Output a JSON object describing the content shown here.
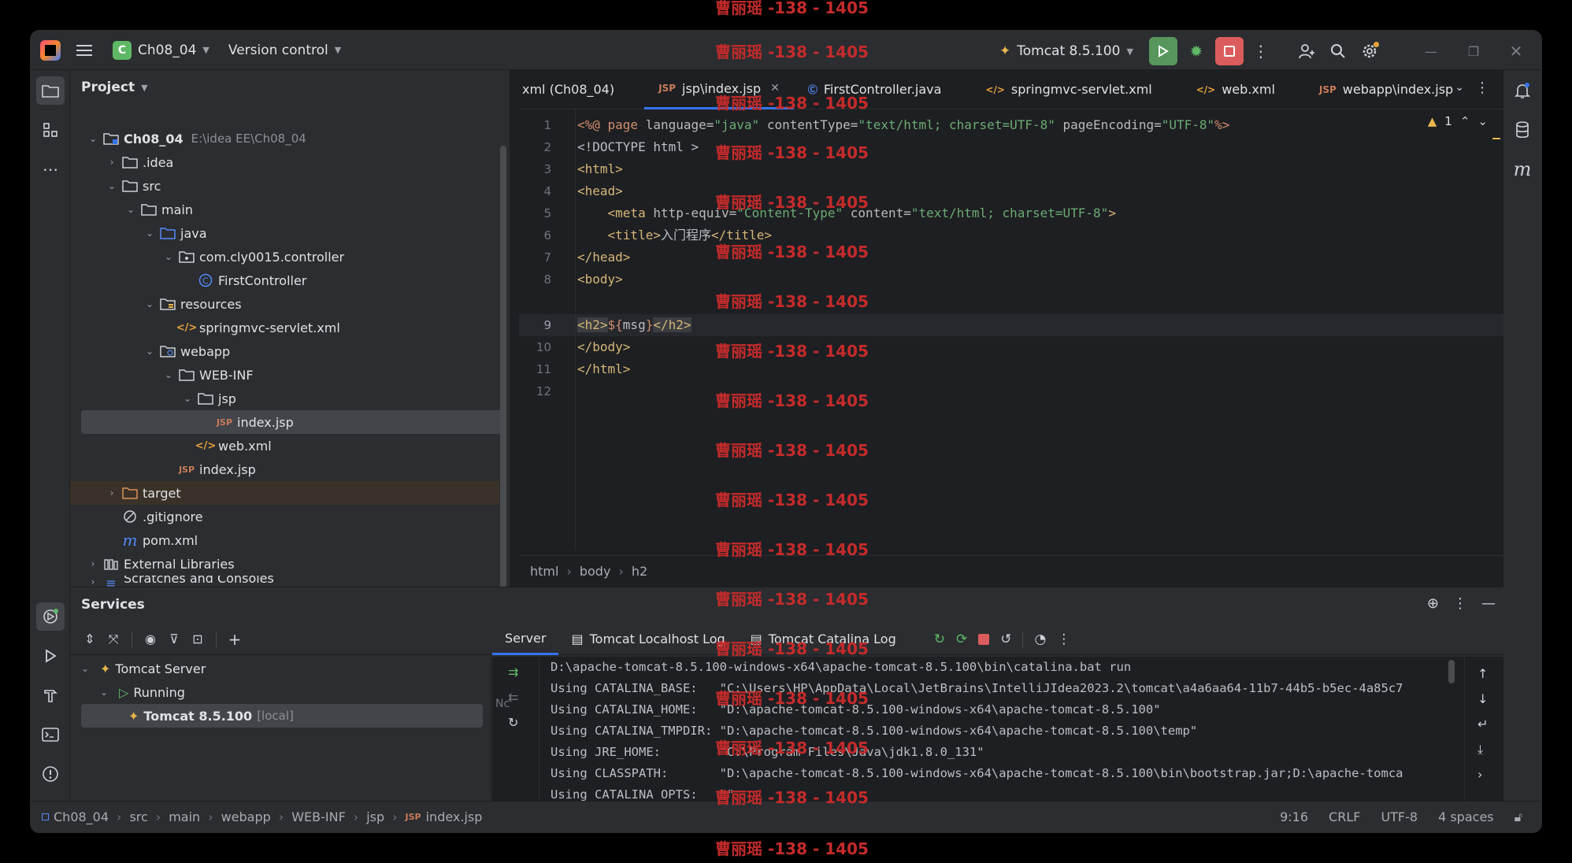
{
  "watermark": "曹丽瑶 -138 - 1405",
  "titlebar": {
    "project_badge": "C",
    "project_name": "Ch08_04",
    "version_control": "Version control",
    "run_config": "Tomcat 8.5.100"
  },
  "project_panel": {
    "title": "Project",
    "tree": [
      {
        "label": "Ch08_04",
        "extra": "E:\\idea EE\\Ch08_04"
      },
      {
        "label": ".idea"
      },
      {
        "label": "src"
      },
      {
        "label": "main"
      },
      {
        "label": "java"
      },
      {
        "label": "com.cly0015.controller"
      },
      {
        "label": "FirstController"
      },
      {
        "label": "resources"
      },
      {
        "label": "springmvc-servlet.xml"
      },
      {
        "label": "webapp"
      },
      {
        "label": "WEB-INF"
      },
      {
        "label": "jsp"
      },
      {
        "label": "index.jsp"
      },
      {
        "label": "web.xml"
      },
      {
        "label": "index.jsp"
      },
      {
        "label": "target"
      },
      {
        "label": ".gitignore"
      },
      {
        "label": "pom.xml"
      },
      {
        "label": "External Libraries"
      },
      {
        "label": "Scratches and Consoles"
      }
    ]
  },
  "editor": {
    "tabs": [
      {
        "label": "xml (Ch08_04)"
      },
      {
        "label": "jsp\\index.jsp"
      },
      {
        "label": "FirstController.java"
      },
      {
        "label": "springmvc-servlet.xml"
      },
      {
        "label": "web.xml"
      },
      {
        "label": "webapp\\index.jsp"
      }
    ],
    "warning_count": "1",
    "line_numbers": [
      "1",
      "2",
      "3",
      "4",
      "5",
      "6",
      "7",
      "8",
      "9",
      "10",
      "11",
      "12"
    ],
    "lines": {
      "l1": [
        "<%@ ",
        "page",
        " language=",
        "\"java\"",
        " contentType=",
        "\"text/html; charset=UTF-8\"",
        " pageEncoding=",
        "\"UTF-8\"",
        "%>"
      ],
      "l2": "<!DOCTYPE html >",
      "l3": "<html>",
      "l4": "<head>",
      "l5": [
        "    <meta ",
        "http-equiv=",
        "\"Content-Type\"",
        " content=",
        "\"text/html; charset=UTF-8\"",
        ">"
      ],
      "l6": [
        "    <title>",
        "入门程序",
        "</title>"
      ],
      "l7": "</head>",
      "l8": "<body>",
      "l9": [
        "<h2>",
        "${",
        "msg",
        "}",
        "</h2>"
      ],
      "l10": "</body>",
      "l11": "</html>"
    },
    "breadcrumb": [
      "html",
      "body",
      "h2"
    ]
  },
  "services": {
    "title": "Services",
    "tree": [
      {
        "label": "Tomcat Server"
      },
      {
        "label": "Running"
      },
      {
        "label": "Tomcat 8.5.100",
        "extra": "[local]"
      }
    ],
    "tabs": [
      "Server",
      "Tomcat Localhost Log",
      "Tomcat Catalina Log"
    ],
    "gutter_label": "Nc",
    "console": [
      "D:\\apache-tomcat-8.5.100-windows-x64\\apache-tomcat-8.5.100\\bin\\catalina.bat run",
      "Using CATALINA_BASE:   \"C:\\Users\\HP\\AppData\\Local\\JetBrains\\IntelliJIdea2023.2\\tomcat\\a4a6aa64-11b7-44b5-b5ec-4a85c7",
      "Using CATALINA_HOME:   \"D:\\apache-tomcat-8.5.100-windows-x64\\apache-tomcat-8.5.100\"",
      "Using CATALINA_TMPDIR: \"D:\\apache-tomcat-8.5.100-windows-x64\\apache-tomcat-8.5.100\\temp\"",
      "Using JRE_HOME:        \"C:\\Program Files\\Java\\jdk1.8.0_131\"",
      "Using CLASSPATH:       \"D:\\apache-tomcat-8.5.100-windows-x64\\apache-tomcat-8.5.100\\bin\\bootstrap.jar;D:\\apache-tomca",
      "Using CATALINA_OPTS:   \"\""
    ]
  },
  "statusbar": {
    "path": [
      "Ch08_04",
      "src",
      "main",
      "webapp",
      "WEB-INF",
      "jsp",
      "index.jsp"
    ],
    "position": "9:16",
    "line_sep": "CRLF",
    "encoding": "UTF-8",
    "indent": "4 spaces"
  },
  "colors": {
    "accent": "#3574f0",
    "run_green": "#57965c",
    "stop_red": "#db5c5c"
  }
}
